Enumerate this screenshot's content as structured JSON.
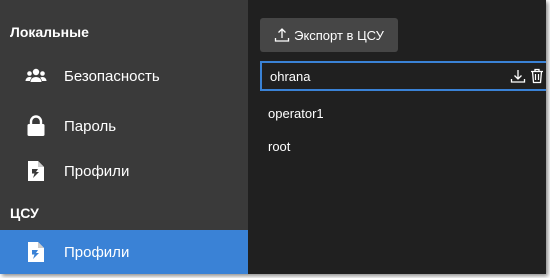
{
  "sidebar": {
    "local_label": "Локальные",
    "local_items": [
      {
        "label": "Безопасность",
        "icon": "users-icon"
      },
      {
        "label": "Пароль",
        "icon": "lock-icon"
      },
      {
        "label": "Профили",
        "icon": "file-profile-icon"
      }
    ],
    "csu_label": "ЦСУ",
    "csu_items": [
      {
        "label": "Профили",
        "icon": "file-profile-icon",
        "active": true
      }
    ]
  },
  "main": {
    "export_button": "Экспорт в ЦСУ",
    "profiles": [
      {
        "name": "ohrana",
        "selected": true
      },
      {
        "name": "operator1",
        "selected": false
      },
      {
        "name": "root",
        "selected": false
      }
    ]
  },
  "colors": {
    "sidebar_bg": "#3a3a3a",
    "main_bg": "#202020",
    "accent": "#3a82d6",
    "button_bg": "#464646"
  }
}
